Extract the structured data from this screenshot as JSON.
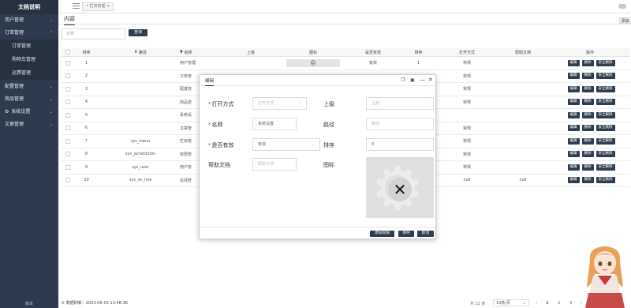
{
  "sidebar": {
    "title": "文档说明",
    "groups": [
      {
        "label": "用户管理"
      },
      {
        "label": "订单管理",
        "children": [
          "订单管理",
          "购物车管理",
          "运费管理"
        ]
      },
      {
        "label": "配置管理"
      },
      {
        "label": "商品管理"
      },
      {
        "label": "系统设置"
      },
      {
        "label": "文章管理"
      }
    ],
    "footer": "版本"
  },
  "topbar": {
    "tab_label": "栏目管理"
  },
  "content": {
    "tab": "内容",
    "add_label": "添加"
  },
  "search": {
    "placeholder": "名称",
    "button": "查询"
  },
  "table": {
    "headers": {
      "sort": "排序",
      "path": "路径",
      "name": "名称",
      "parent": "上级",
      "icon": "图标",
      "valid": "是否有效",
      "order": "排序",
      "open": "打开方式",
      "help": "帮助文档",
      "ops": "操作"
    },
    "ops": [
      "编辑",
      "删除",
      "安全删除"
    ],
    "rows": [
      {
        "sort": "1",
        "path": "",
        "name": "用户管理",
        "valid": "有效",
        "order": "1",
        "open": "常规",
        "help": "",
        "icon": "☹"
      },
      {
        "sort": "2",
        "path": "",
        "name": "订单管",
        "valid": "",
        "order": "",
        "open": "常规",
        "help": ""
      },
      {
        "sort": "3",
        "path": "",
        "name": "配置管",
        "valid": "",
        "order": "",
        "open": "常规",
        "help": ""
      },
      {
        "sort": "4",
        "path": "",
        "name": "商品管",
        "valid": "",
        "order": "",
        "open": "常规",
        "help": ""
      },
      {
        "sort": "5",
        "path": "",
        "name": "系统设",
        "valid": "",
        "order": "",
        "open": "",
        "help": ""
      },
      {
        "sort": "6",
        "path": "",
        "name": "文章管",
        "valid": "",
        "order": "",
        "open": "常规",
        "help": ""
      },
      {
        "sort": "7",
        "path": "sys_menu",
        "name": "栏目管",
        "valid": "",
        "order": "",
        "open": "常规",
        "help": ""
      },
      {
        "sort": "8",
        "path": "sys_jurisdiction",
        "name": "权限管",
        "valid": "",
        "order": "",
        "open": "常规",
        "help": ""
      },
      {
        "sort": "9",
        "path": "sys_user",
        "name": "用户管",
        "valid": "",
        "order": "",
        "open": "常规",
        "help": ""
      },
      {
        "sort": "10",
        "path": "sys_on_line",
        "name": "在线管",
        "valid": "",
        "order": "",
        "open": "null",
        "help": "null"
      }
    ]
  },
  "dialog": {
    "title": "编辑",
    "fields": {
      "open_mode": {
        "label": "打开方式",
        "placeholder": "打开方式"
      },
      "parent": {
        "label": "上级",
        "placeholder": "上级"
      },
      "name": {
        "label": "名称",
        "value": "系统设置"
      },
      "path": {
        "label": "路径",
        "placeholder": "路径"
      },
      "valid": {
        "label": "是否有效",
        "value": "有效"
      },
      "order": {
        "label": "排序",
        "value": "0"
      },
      "help": {
        "label": "帮助文档",
        "placeholder": "帮助文档"
      },
      "icon": {
        "label": "图标"
      }
    },
    "buttons": {
      "add_perm": "添加权限",
      "save": "保存",
      "cancel": "取消"
    }
  },
  "footer": {
    "refresh": "数据刷新：2023-06-03 13:48:36",
    "total": "共 22 条",
    "page_size": "10条/页",
    "pages": [
      "1",
      "2",
      "3"
    ],
    "current_page": "1"
  },
  "colors": {
    "sidebar_bg": "#2e3b4e",
    "button_bg": "#2f3d4f",
    "accent": "#2f6bd6"
  }
}
